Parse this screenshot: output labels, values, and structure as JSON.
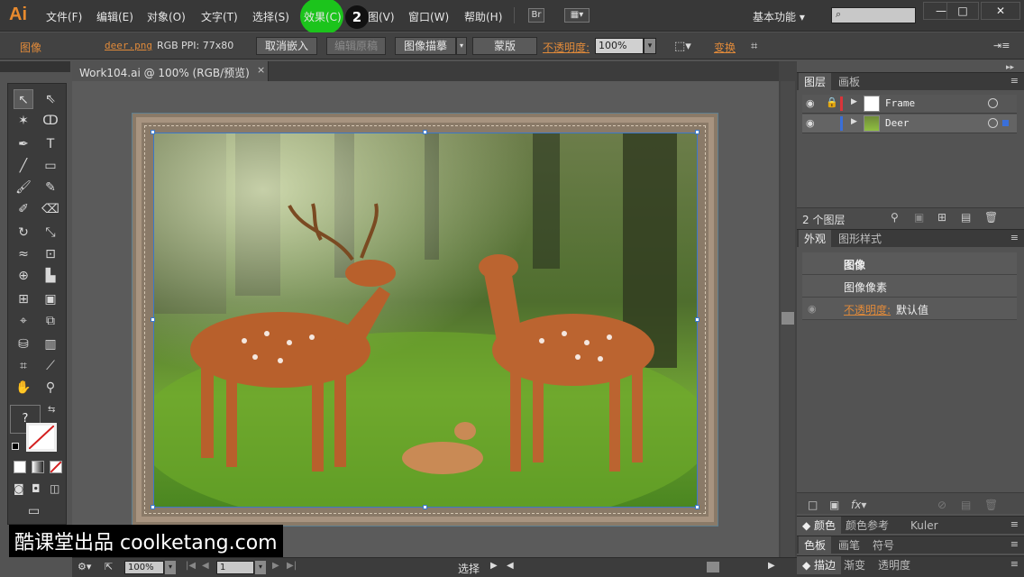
{
  "app": {
    "logo": "Ai"
  },
  "menu": {
    "items": [
      {
        "label": "文件(F)"
      },
      {
        "label": "编辑(E)"
      },
      {
        "label": "对象(O)"
      },
      {
        "label": "文字(T)"
      },
      {
        "label": "选择(S)"
      },
      {
        "label": "效果(C)"
      },
      {
        "label": "图(V)"
      },
      {
        "label": "窗口(W)"
      },
      {
        "label": "帮助(H)"
      }
    ],
    "step_badge": "2",
    "bridge_label": "Br",
    "workspace": "基本功能",
    "search_placeholder": "",
    "window_buttons": [
      "—",
      "□",
      "✕"
    ]
  },
  "control": {
    "selection_type": "图像",
    "file_name": "deer.png",
    "color_mode": "RGB",
    "ppi": "PPI: 77x80",
    "unembed": "取消嵌入",
    "edit_original": "编辑原稿",
    "image_trace": "图像描摹",
    "mask": "蒙版",
    "opacity_label": "不透明度:",
    "opacity_value": "100%",
    "transform": "变换"
  },
  "document": {
    "tab_title": "Work104.ai @ 100% (RGB/预览)",
    "close": "×"
  },
  "tools": {
    "fill_stroke_query": "?"
  },
  "status": {
    "zoom": "100%",
    "page": "1",
    "tool": "选择"
  },
  "layers_panel": {
    "tabs": [
      "图层",
      "画板"
    ],
    "layers": [
      {
        "name": "Frame",
        "color": "#d9343a"
      },
      {
        "name": "Deer",
        "color": "#3a6fd9"
      }
    ],
    "count": "2 个图层"
  },
  "appearance_panel": {
    "tabs": [
      "外观",
      "图形样式"
    ],
    "title": "图像",
    "subtitle": "图像像素",
    "opacity_label": "不透明度:",
    "opacity_value": "默认值"
  },
  "collapsed_panels": {
    "row1": [
      "颜色",
      "颜色参考",
      "Kuler"
    ],
    "row2": [
      "色板",
      "画笔",
      "符号"
    ],
    "row3": [
      "描边",
      "渐变",
      "透明度"
    ]
  },
  "watermark": "酷课堂出品 coolketang.com",
  "colors": {
    "accent": "#e08a3a",
    "highlight": "#1cc41c"
  }
}
